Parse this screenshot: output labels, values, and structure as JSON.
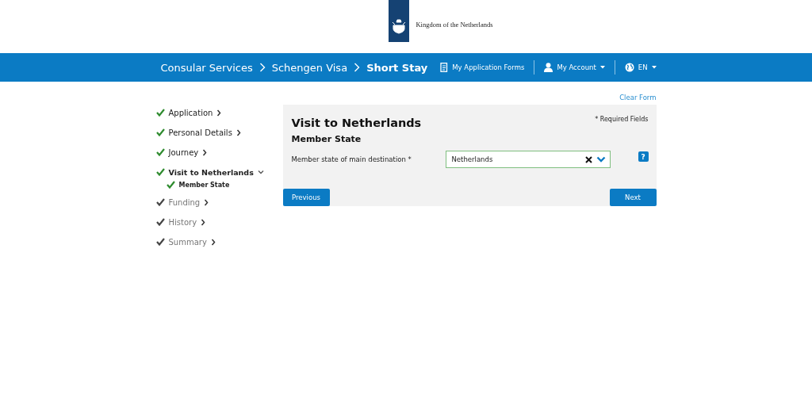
{
  "brand": {
    "name": "Kingdom of the Netherlands"
  },
  "breadcrumbs": [
    {
      "label": "Consular Services",
      "current": false
    },
    {
      "label": "Schengen Visa",
      "current": false
    },
    {
      "label": "Short Stay",
      "current": true
    }
  ],
  "nav": {
    "forms": "My Application Forms",
    "account": "My Account",
    "language": "EN"
  },
  "clear_form": "Clear Form",
  "steps": [
    {
      "label": "Application",
      "done": true,
      "current": false,
      "expanded": false
    },
    {
      "label": "Personal Details",
      "done": true,
      "current": false,
      "expanded": false
    },
    {
      "label": "Journey",
      "done": true,
      "current": false,
      "expanded": false
    },
    {
      "label": "Visit to Netherlands",
      "done": true,
      "current": true,
      "expanded": true,
      "children": [
        {
          "label": "Member State",
          "done": true
        }
      ]
    },
    {
      "label": "Funding",
      "done": false,
      "current": false,
      "expanded": false
    },
    {
      "label": "History",
      "done": false,
      "current": false,
      "expanded": false
    },
    {
      "label": "Summary",
      "done": false,
      "current": false,
      "expanded": false
    }
  ],
  "form": {
    "title": "Visit to Netherlands",
    "required_note": "* Required Fields",
    "section": "Member State",
    "fields": [
      {
        "label": "Member state of main destination *",
        "value": "Netherlands",
        "help": "?"
      }
    ],
    "buttons": {
      "previous": "Previous",
      "next": "Next"
    }
  }
}
